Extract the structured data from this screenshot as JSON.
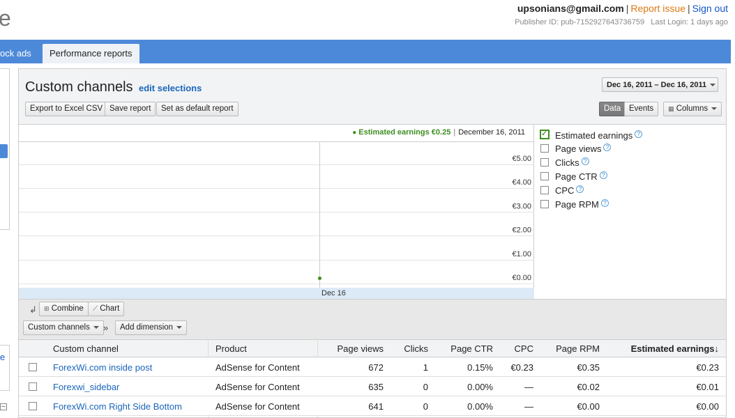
{
  "header": {
    "logo_fragment": "e",
    "email": "upsonians@gmail.com",
    "report_issue": "Report issue",
    "sign_out": "Sign out",
    "publisher_id": "Publisher ID: pub-7152927643736759",
    "last_login": "Last Login: 1 days ago"
  },
  "nav": {
    "tab_partial": "ock ads",
    "tab_active": "Performance reports"
  },
  "sidebar": {
    "link_fragment": "e",
    "collapse": "–"
  },
  "report": {
    "title": "Custom channels",
    "edit_selections": "edit selections",
    "date_range": "Dec 16, 2011 – Dec 16, 2011",
    "export_label": "Export to Excel CSV",
    "save_label": "Save report",
    "default_label": "Set as default report",
    "data_label": "Data",
    "events_label": "Events",
    "columns_label": "Columns"
  },
  "chart_legend": {
    "metric": "Estimated earnings €0.25",
    "date": "December 16, 2011"
  },
  "chart_data": {
    "type": "line",
    "x": [
      "Dec 16"
    ],
    "series": [
      {
        "name": "Estimated earnings",
        "values": [
          0.25
        ]
      }
    ],
    "y_ticks": [
      "€5.00",
      "€4.00",
      "€3.00",
      "€2.00",
      "€1.00",
      "€0.00"
    ],
    "ylim": [
      0,
      5
    ],
    "grid": true,
    "color": "#3d8f1f"
  },
  "metrics": [
    {
      "label": "Estimated earnings",
      "checked": true
    },
    {
      "label": "Page views",
      "checked": false
    },
    {
      "label": "Clicks",
      "checked": false
    },
    {
      "label": "Page CTR",
      "checked": false
    },
    {
      "label": "CPC",
      "checked": false
    },
    {
      "label": "Page RPM",
      "checked": false
    }
  ],
  "toolbar": {
    "combine": "Combine",
    "chart": "Chart",
    "dimension_select": "Custom channels",
    "breadcrumb_sep": "»",
    "add_dimension": "Add dimension"
  },
  "table": {
    "headers": [
      "Custom channel",
      "Product",
      "Page views",
      "Clicks",
      "Page CTR",
      "CPC",
      "Page RPM",
      "Estimated earnings↓"
    ],
    "rows": [
      [
        "ForexWi.com inside post",
        "AdSense for Content",
        "672",
        "1",
        "0.15%",
        "€0.23",
        "€0.35",
        "€0.23"
      ],
      [
        "Forexwi_sidebar",
        "AdSense for Content",
        "635",
        "0",
        "0.00%",
        "—",
        "€0.02",
        "€0.01"
      ],
      [
        "ForexWi.com Right Side Bottom",
        "AdSense for Content",
        "641",
        "0",
        "0.00%",
        "—",
        "€0.00",
        "€0.00"
      ]
    ]
  },
  "colors": {
    "nav_blue": "#4d89d9",
    "earnings_green": "#3d8f1f",
    "link_blue": "#1a66bb",
    "report_issue_orange": "#dd7711"
  }
}
